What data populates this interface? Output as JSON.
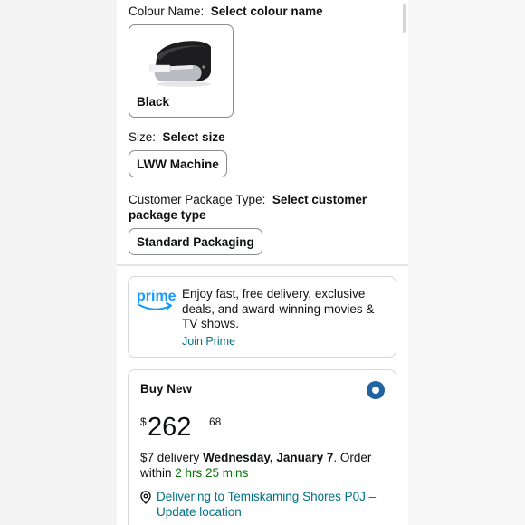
{
  "colour": {
    "label": "Colour Name:",
    "value": "Select colour name",
    "options": [
      {
        "name": "Black",
        "image": "label-printer"
      }
    ]
  },
  "size": {
    "label": "Size:",
    "value": "Select size",
    "options": [
      "LWW Machine"
    ]
  },
  "package": {
    "label": "Customer Package Type:",
    "value": "Select customer package type",
    "options": [
      "Standard Packaging"
    ]
  },
  "prime": {
    "logo_text": "prime",
    "text": "Enjoy fast, free delivery, exclusive deals, and award-winning movies & TV shows.",
    "link": "Join Prime"
  },
  "buy": {
    "title": "Buy New",
    "selected": true,
    "currency": "$",
    "price_whole": "262",
    "price_fraction": "68",
    "delivery_prefix": "$7 delivery",
    "delivery_date": "Wednesday, January 7",
    "delivery_mid": ". Order within",
    "delivery_time": "2 hrs 25 mins",
    "location": "Delivering to Temiskaming Shores P0J – Update location"
  },
  "colors": {
    "accent_blue": "#2162a1",
    "link": "#007185",
    "prime": "#1399ff",
    "in_time": "#007600"
  },
  "icons": [
    "label-printer-image",
    "prime-smile-icon",
    "radio-selected-icon",
    "location-pin-icon"
  ]
}
